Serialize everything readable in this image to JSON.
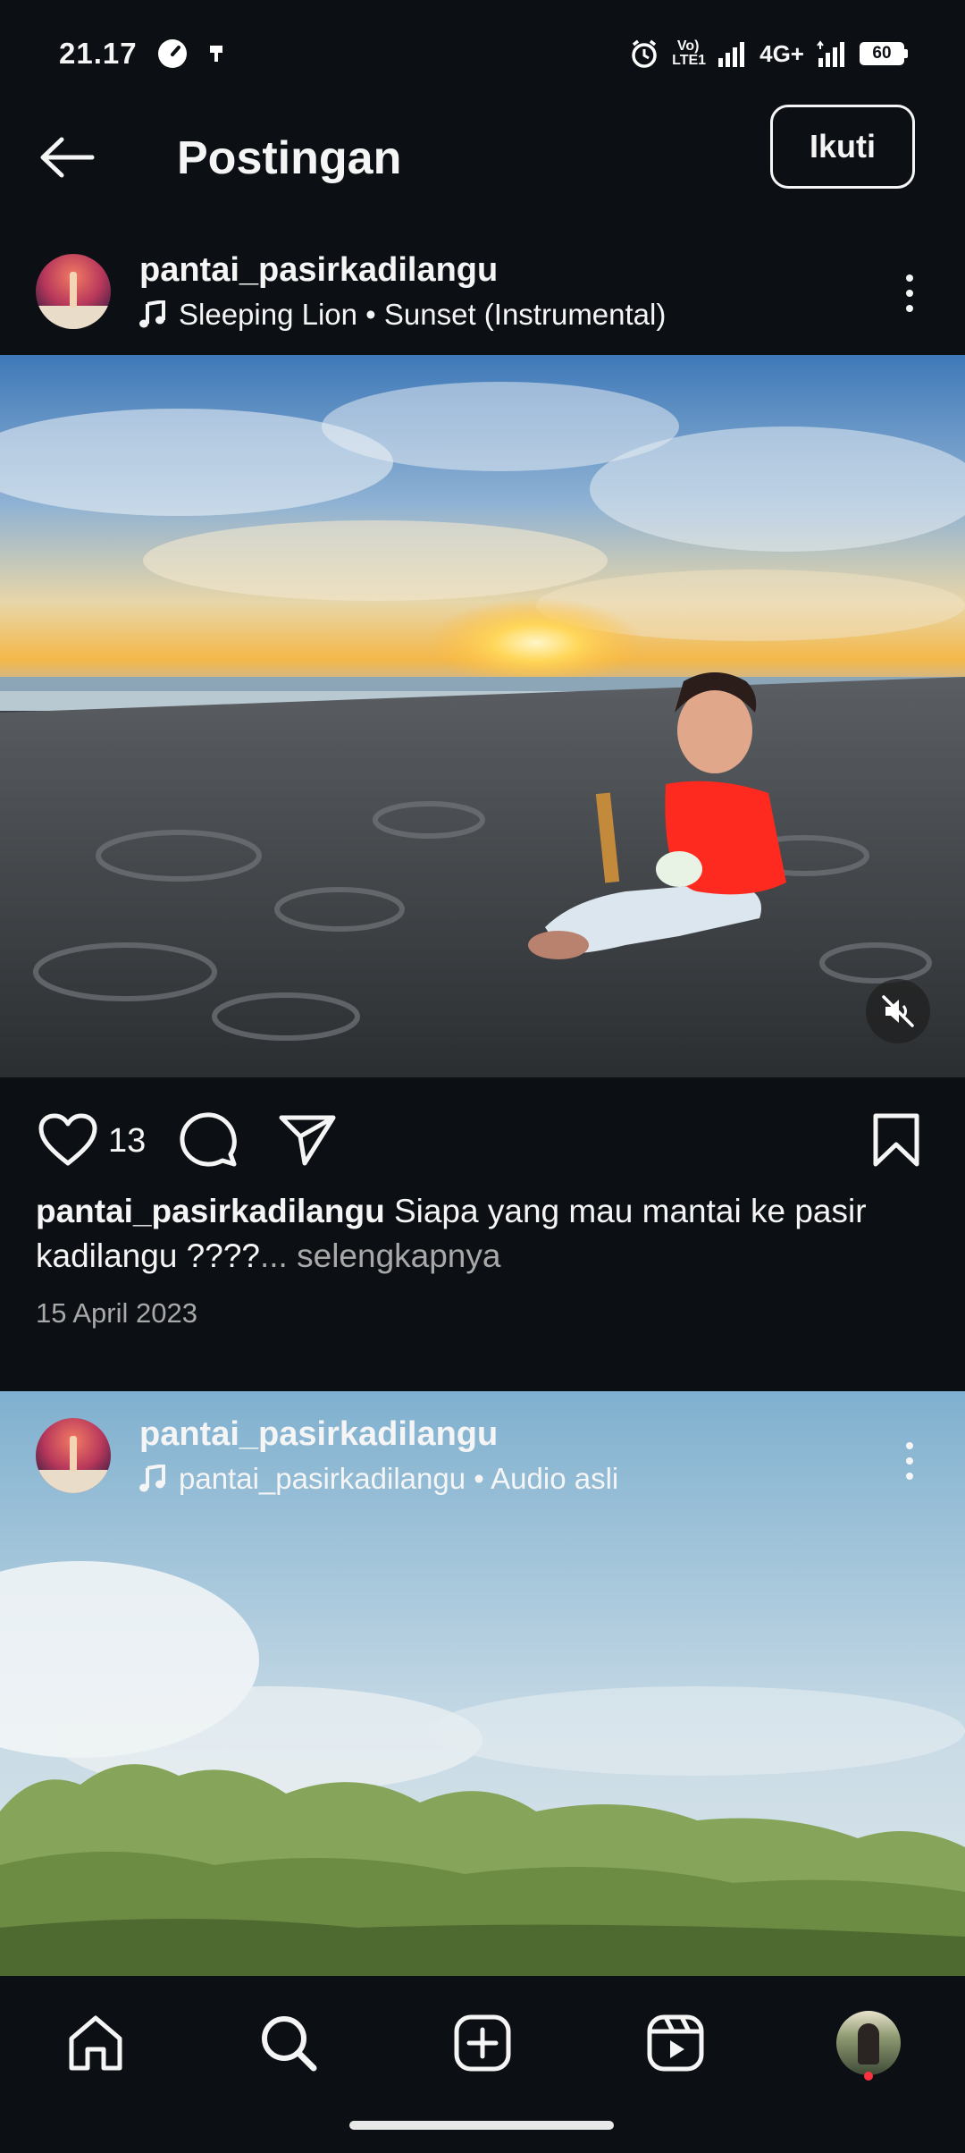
{
  "status_bar": {
    "time": "21.17",
    "network": "4G+",
    "volte": "VoLTE1",
    "battery": "60"
  },
  "header": {
    "title": "Postingan",
    "follow_label": "Ikuti"
  },
  "post1": {
    "username": "pantai_pasirkadilangu",
    "audio": "Sleeping Lion • Sunset (Instrumental)",
    "likes": "13",
    "caption_user": "pantai_pasirkadilangu",
    "caption_text": " Siapa yang mau mantai ke pasir kadilangu ????",
    "caption_more": "... selengkapnya",
    "date": "15 April 2023"
  },
  "post2": {
    "username": "pantai_pasirkadilangu",
    "audio": "pantai_pasirkadilangu • Audio asli"
  },
  "nav": {
    "items": [
      "home-icon",
      "search-icon",
      "create-icon",
      "reels-icon",
      "profile-avatar"
    ]
  },
  "colors": {
    "background": "#0c1014",
    "text": "#f5f5f5",
    "muted": "#a8a8a8",
    "notification_dot": "#ff3040"
  }
}
